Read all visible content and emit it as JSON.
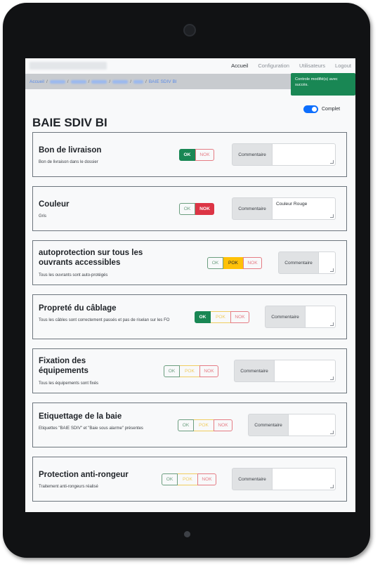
{
  "nav": {
    "links": [
      "Accueil",
      "Configuration",
      "Utilisateurs",
      "Logout"
    ]
  },
  "breadcrumb": {
    "first": "Accueil",
    "last": "BAIE SDIV BI"
  },
  "toast": {
    "message": "Controle modifié(s) avec succès."
  },
  "switch": {
    "label": "Complet",
    "checked": true
  },
  "page_title": "BAIE SDIV BI",
  "labels": {
    "ok": "OK",
    "pok": "POK",
    "nok": "NOK",
    "comment": "Commentaire"
  },
  "checks": [
    {
      "title": "Bon de livraison",
      "description": "Bon de livraison dans le dossier",
      "state": "OK",
      "comment": ""
    },
    {
      "title": "Couleur",
      "description": "Gris",
      "state": "NOK",
      "comment": "Couleur Rouge"
    },
    {
      "title": "autoprotection sur tous les ouvrants accessibles",
      "description": "Tous les ouvrants sont auto-protégés",
      "state": "POK",
      "comment": ""
    },
    {
      "title": "Propreté du câblage",
      "description": "Tous les câbles sont correctement passés et pas de riselan sur les FO",
      "state": "OK",
      "comment": ""
    },
    {
      "title": "Fixation des équipements",
      "description": "Tous les équipements sont fixés",
      "state": "",
      "comment": ""
    },
    {
      "title": "Etiquettage de la baie",
      "description": "Etiquettes \"BAIE SDIV\" et \"Baie sous alarme\" présentes",
      "state": "",
      "comment": ""
    },
    {
      "title": "Protection anti-rongeur",
      "description": "Traitement anti-rongeurs réalisé",
      "state": "",
      "comment": ""
    }
  ],
  "colors": {
    "ok": "#198754",
    "pok": "#ffc107",
    "nok": "#dc3545",
    "toast": "#198754",
    "link": "#5a8be8",
    "switch": "#0d6efd"
  }
}
